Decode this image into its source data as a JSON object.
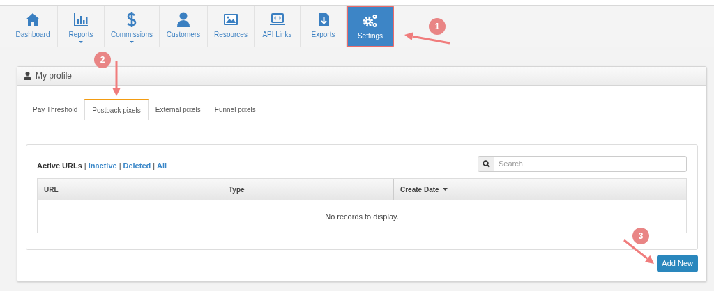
{
  "nav": [
    {
      "label": "Dashboard",
      "dropdown": false,
      "selected": false
    },
    {
      "label": "Reports",
      "dropdown": true,
      "selected": false
    },
    {
      "label": "Commissions",
      "dropdown": true,
      "selected": false
    },
    {
      "label": "Customers",
      "dropdown": false,
      "selected": false
    },
    {
      "label": "Resources",
      "dropdown": false,
      "selected": false
    },
    {
      "label": "API Links",
      "dropdown": false,
      "selected": false
    },
    {
      "label": "Exports",
      "dropdown": false,
      "selected": false
    },
    {
      "label": "Settings",
      "dropdown": false,
      "selected": true
    }
  ],
  "panel": {
    "title": "My profile",
    "tabs": [
      {
        "label": "Pay Threshold",
        "selected": false
      },
      {
        "label": "Postback pixels",
        "selected": true
      },
      {
        "label": "External pixels",
        "selected": false
      },
      {
        "label": "Funnel pixels",
        "selected": false
      }
    ],
    "filters": [
      {
        "label": "Active URLs",
        "selected": true
      },
      {
        "label": "Inactive",
        "selected": false
      },
      {
        "label": "Deleted",
        "selected": false
      },
      {
        "label": "All",
        "selected": false
      }
    ],
    "separator": "|",
    "search": {
      "placeholder": "Search"
    },
    "table": {
      "columns": [
        {
          "label": "URL",
          "sorted": false
        },
        {
          "label": "Type",
          "sorted": false
        },
        {
          "label": "Create Date",
          "sorted": true
        }
      ],
      "empty_message": "No records to display."
    },
    "add_button": "Add New"
  },
  "callouts": [
    {
      "number": "1"
    },
    {
      "number": "2"
    },
    {
      "number": "3"
    }
  ]
}
